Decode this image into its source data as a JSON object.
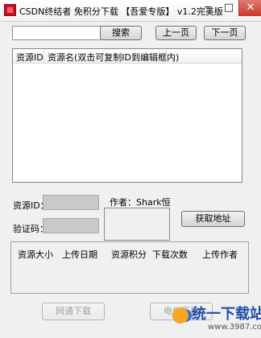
{
  "window": {
    "title": "CSDN终结者 免积分下载 【吾爱专版】 v1.2完美版",
    "minimize_glyph": "─",
    "maximize_glyph": "□",
    "close_glyph": "✕"
  },
  "search": {
    "value": "",
    "placeholder": "",
    "search_label": "搜索",
    "prev_label": "上一页",
    "next_label": "下一页"
  },
  "list": {
    "columns": [
      "资源ID",
      "资源名(双击可复制ID到编辑框内)"
    ],
    "rows": []
  },
  "info": {
    "resource_id_label": "资源ID：",
    "resource_id_value": "",
    "captcha_label": "验证码：",
    "captcha_value": "",
    "author_text": "作者：Shark恒",
    "get_address_label": "获取地址"
  },
  "details": {
    "columns": [
      "资源大小",
      "上传日期",
      "资源积分",
      "下载次数",
      "上传作者"
    ]
  },
  "actions": {
    "netcom_download_label": "网通下载",
    "telecom_download_label": "电信下载"
  },
  "watermark": {
    "main": "统一下载站",
    "url": "www.3987.com"
  }
}
